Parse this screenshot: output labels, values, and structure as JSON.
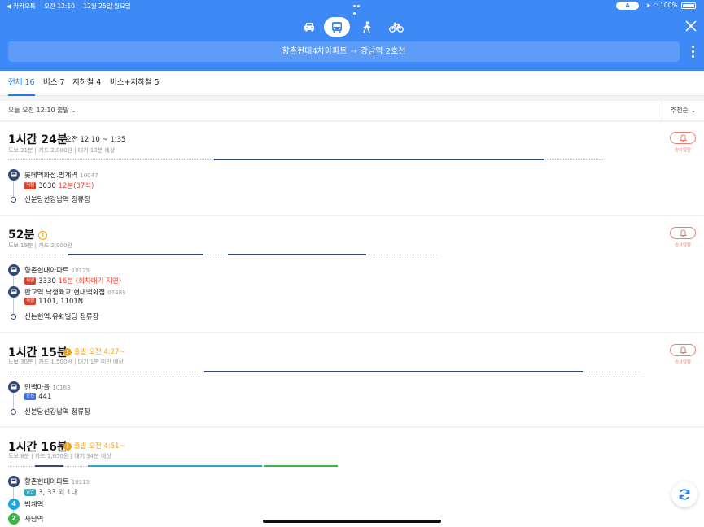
{
  "status": {
    "carrier": "◀ 카카오톡",
    "time": "오전 12:10",
    "date": "12월 25일 월요일",
    "vpn": "A",
    "battery": "100%"
  },
  "route": {
    "origin": "향촌현대4차아파트",
    "arrow": "→",
    "destination": "강남역 2호선"
  },
  "tabs": [
    {
      "label": "전체 16"
    },
    {
      "label": "버스 7"
    },
    {
      "label": "지하철 4"
    },
    {
      "label": "버스+지하철 5"
    }
  ],
  "sort": {
    "when": "오늘 오전 12:10 출발",
    "order": "추천순"
  },
  "alarm_label": "승차알람",
  "colors": {
    "header": "#3d8af7",
    "bus_navy": "#304878",
    "bus_red": "#e0402a",
    "bus_blue": "#3b6ee0",
    "bus_teal": "#25a9c6",
    "line4": "#1ba7e3",
    "line2": "#3cb44a",
    "warn": "#f2a31a"
  },
  "cards": [
    {
      "duration": "1시간 24분",
      "time_range": "오전 12:10 ~ 1:35",
      "meta": "도보 31분 | 카드 2,800원 | 대기 13분 예상",
      "stops": [
        {
          "name": "롯데백화점.범계역",
          "id": "10047",
          "badge": "직행",
          "bus": "3030",
          "note": "12분(37석)"
        }
      ],
      "end": "신분당선강남역 정류장"
    },
    {
      "duration": "52분",
      "warning": "!",
      "meta": "도보 19분 | 카드 2,900원",
      "stops": [
        {
          "name": "향촌현대아파트",
          "id": "10125",
          "badge": "직행",
          "bus": "3330",
          "note": "16분 (회차대기 지연)"
        },
        {
          "name": "판교역.낙생육교.현대백화점",
          "id": "07489",
          "badge": "직행",
          "bus": "1101, 1101N"
        }
      ],
      "end": "신논현역.유화빌딩 정류장"
    },
    {
      "duration": "1시간 15분",
      "depart": "출발 오전 4:27~",
      "meta": "도보 30분 | 카드 1,500원 | 대기 1분 미만 예상",
      "stops": [
        {
          "name": "민백마을",
          "id": "10163",
          "badge": "간선",
          "bus": "441"
        }
      ],
      "end": "신분당선강남역 정류장"
    },
    {
      "duration": "1시간 16분",
      "depart": "출발 오전 4:51~",
      "meta": "도보 8분 | 카드 1,650원 | 대기 34분 예상",
      "stops": [
        {
          "name": "향촌현대아파트",
          "id": "10115",
          "badge": "일반",
          "bus": "3, 33",
          "extra": "외 1대"
        }
      ],
      "subway": [
        {
          "num": "4",
          "name": "범계역"
        },
        {
          "num": "2",
          "name": "사당역"
        }
      ]
    }
  ]
}
